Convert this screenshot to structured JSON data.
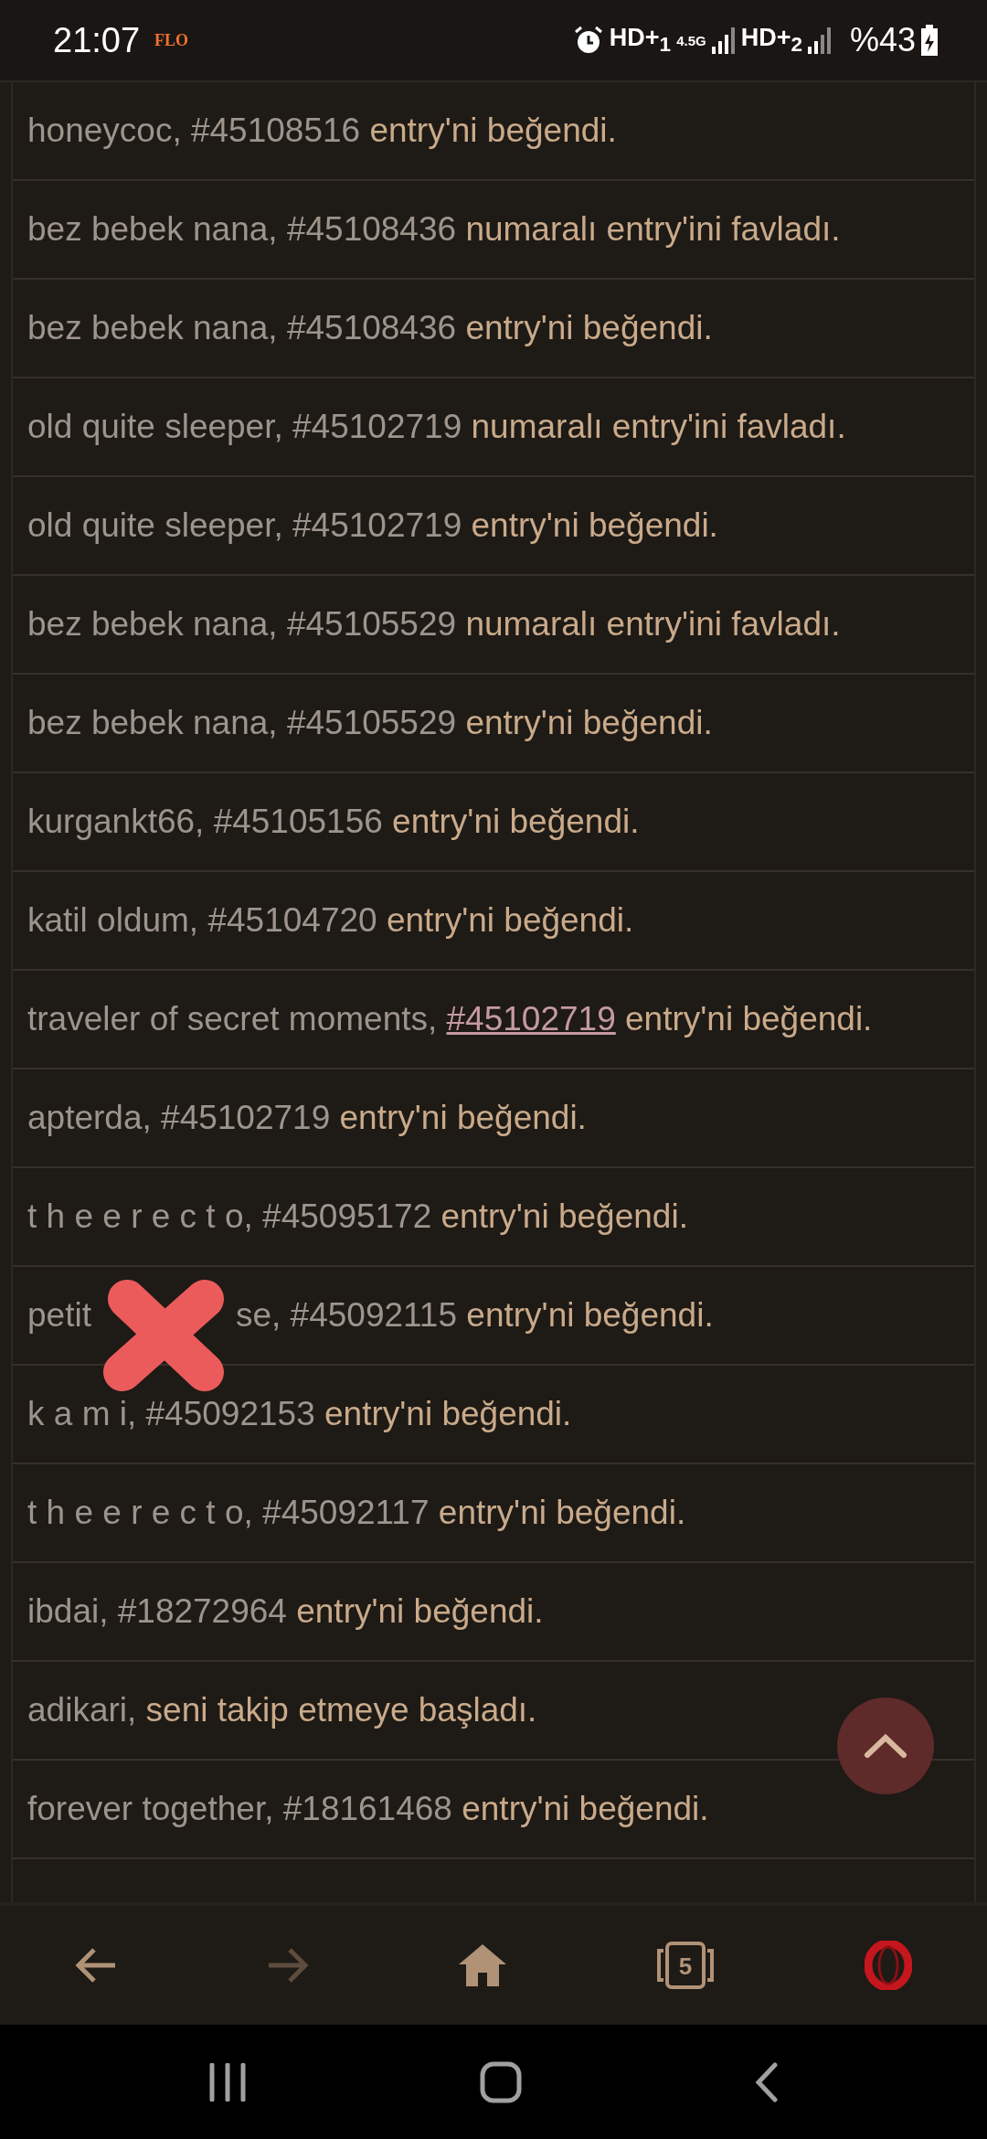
{
  "status_bar": {
    "time": "21:07",
    "app_badge": "FLO",
    "network_1": "HD+$_{1}$",
    "network_type": "4.5G",
    "network_2": "HD+$_{2}$",
    "battery": "%43"
  },
  "notifications": [
    {
      "parts": [
        {
          "kind": "subject",
          "text": "honeycoc, #45108516"
        },
        {
          "kind": "action",
          "text": "entry'ni beğendi."
        }
      ]
    },
    {
      "parts": [
        {
          "kind": "subject",
          "text": "bez bebek nana, #45108436"
        },
        {
          "kind": "action",
          "text": "numaralı entry'ini favladı."
        }
      ]
    },
    {
      "parts": [
        {
          "kind": "subject",
          "text": "bez bebek nana, #45108436"
        },
        {
          "kind": "action",
          "text": "entry'ni beğendi."
        }
      ]
    },
    {
      "parts": [
        {
          "kind": "subject",
          "text": "old quite sleeper, #45102719"
        },
        {
          "kind": "action",
          "text": "numaralı entry'ini favladı."
        }
      ]
    },
    {
      "parts": [
        {
          "kind": "subject",
          "text": "old quite sleeper, #45102719"
        },
        {
          "kind": "action",
          "text": "entry'ni beğendi."
        }
      ]
    },
    {
      "parts": [
        {
          "kind": "subject",
          "text": "bez bebek nana, #45105529"
        },
        {
          "kind": "action",
          "text": "numaralı entry'ini favladı."
        }
      ]
    },
    {
      "parts": [
        {
          "kind": "subject",
          "text": "bez bebek nana, #45105529"
        },
        {
          "kind": "action",
          "text": "entry'ni beğendi."
        }
      ]
    },
    {
      "parts": [
        {
          "kind": "subject",
          "text": "kurgankt66, #45105156"
        },
        {
          "kind": "action",
          "text": "entry'ni beğendi."
        }
      ]
    },
    {
      "parts": [
        {
          "kind": "subject",
          "text": "katil oldum, #45104720"
        },
        {
          "kind": "action",
          "text": "entry'ni beğendi."
        }
      ]
    },
    {
      "parts": [
        {
          "kind": "subject",
          "text": "traveler of secret moments,"
        },
        {
          "kind": "link",
          "text": "#45102719"
        },
        {
          "kind": "action",
          "text": "entry'ni beğendi."
        }
      ]
    },
    {
      "parts": [
        {
          "kind": "subject",
          "text": "apterda, #45102719"
        },
        {
          "kind": "action",
          "text": "entry'ni beğendi."
        }
      ]
    },
    {
      "parts": [
        {
          "kind": "subject",
          "text": "t h e e r e c t o, #45095172"
        },
        {
          "kind": "action",
          "text": "entry'ni beğendi."
        }
      ]
    },
    {
      "parts": [
        {
          "kind": "subject",
          "text": "petit"
        },
        {
          "kind": "redaction"
        },
        {
          "kind": "subject",
          "text": "se, #45092115"
        },
        {
          "kind": "action",
          "text": "entry'ni beğendi."
        }
      ]
    },
    {
      "parts": [
        {
          "kind": "subject",
          "text": "k a m i, #45092153"
        },
        {
          "kind": "action",
          "text": "entry'ni beğendi."
        }
      ]
    },
    {
      "parts": [
        {
          "kind": "subject",
          "text": "t h e e r e c t o, #45092117"
        },
        {
          "kind": "action",
          "text": "entry'ni beğendi."
        }
      ]
    },
    {
      "parts": [
        {
          "kind": "subject",
          "text": "ibdai, #18272964"
        },
        {
          "kind": "action",
          "text": "entry'ni beğendi."
        }
      ]
    },
    {
      "parts": [
        {
          "kind": "subject",
          "text": "adikari,"
        },
        {
          "kind": "action",
          "text": "seni takip etmeye başladı."
        }
      ]
    },
    {
      "parts": [
        {
          "kind": "subject",
          "text": "forever together, #18161468"
        },
        {
          "kind": "action",
          "text": "entry'ni beğendi."
        }
      ]
    }
  ],
  "browser_toolbar": {
    "back": {
      "disabled": false
    },
    "forward": {
      "disabled": true
    },
    "tab_count": "5"
  }
}
